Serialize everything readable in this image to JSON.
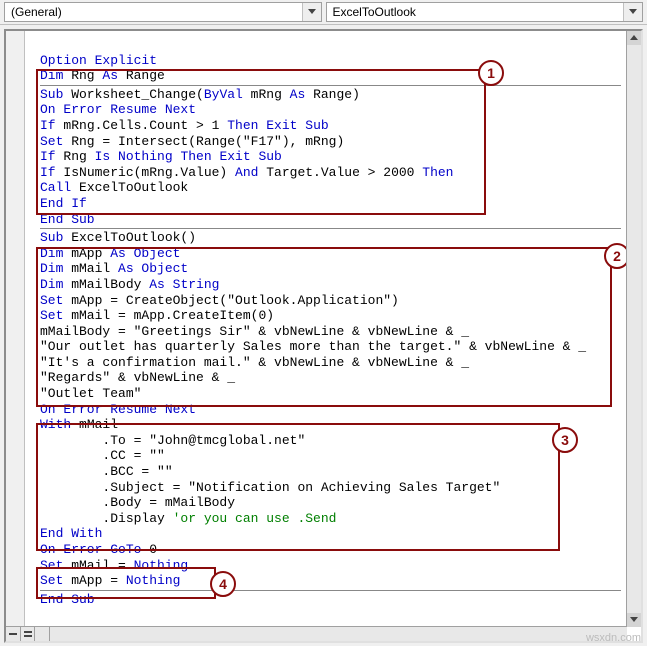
{
  "toolbar": {
    "left_dropdown": "(General)",
    "right_dropdown": "ExcelToOutlook"
  },
  "code": {
    "l01": {
      "a": "Option Explicit"
    },
    "l02": {
      "a": "Dim",
      "b": " Rng ",
      "c": "As",
      "d": " Range"
    },
    "l03": {
      "a": "Sub",
      "b": " Worksheet_Change(",
      "c": "ByVal",
      "d": " mRng ",
      "e": "As",
      "f": " Range)"
    },
    "l04": {
      "a": "On Error Resume Next"
    },
    "l05": {
      "a": "If",
      "b": " mRng.Cells.Count > 1 ",
      "c": "Then Exit Sub"
    },
    "l06": {
      "a": "Set",
      "b": " Rng = Intersect(Range(\"F17\"), mRng)"
    },
    "l07": {
      "a": "If",
      "b": " Rng ",
      "c": "Is Nothing Then Exit Sub"
    },
    "l08": {
      "a": "If",
      "b": " IsNumeric(mRng.Value) ",
      "c": "And",
      "d": " Target.Value > 2000 ",
      "e": "Then"
    },
    "l09": {
      "a": "Call",
      "b": " ExcelToOutlook"
    },
    "l10": {
      "a": "End If"
    },
    "l11": {
      "a": "End Sub"
    },
    "l12": {
      "a": "Sub",
      "b": " ExcelToOutlook()"
    },
    "l13": {
      "a": "Dim",
      "b": " mApp ",
      "c": "As Object"
    },
    "l14": {
      "a": "Dim",
      "b": " mMail ",
      "c": "As Object"
    },
    "l15": {
      "a": "Dim",
      "b": " mMailBody ",
      "c": "As String"
    },
    "l16": {
      "a": "Set",
      "b": " mApp = CreateObject(\"Outlook.Application\")"
    },
    "l17": {
      "a": "Set",
      "b": " mMail = mApp.CreateItem(0)"
    },
    "l18": {
      "a": "mMailBody = \"Greetings Sir\" & vbNewLine & vbNewLine & _"
    },
    "l19": {
      "a": "\"Our outlet has quarterly Sales more than the target.\" & vbNewLine & _"
    },
    "l20": {
      "a": "\"It's a confirmation mail.\" & vbNewLine & vbNewLine & _"
    },
    "l21": {
      "a": "\"Regards\" & vbNewLine & _"
    },
    "l22": {
      "a": "\"Outlet Team\""
    },
    "l23": {
      "a": "On Error Resume Next"
    },
    "l24": {
      "a": "With",
      "b": " mMail"
    },
    "l25": {
      "a": "        .To = \"John@tmcglobal.net\""
    },
    "l26": {
      "a": "        .CC = \"\""
    },
    "l27": {
      "a": "        .BCC = \"\""
    },
    "l28": {
      "a": "        .Subject = \"Notification on Achieving Sales Target\""
    },
    "l29": {
      "a": "        .Body = mMailBody"
    },
    "l30": {
      "a": "        .Display ",
      "b": "'or you can use .Send"
    },
    "l31": {
      "a": "End With"
    },
    "l32": {
      "a": "On Error GoTo",
      "b": " 0"
    },
    "l33": {
      "a": "Set",
      "b": " mMail = ",
      "c": "Nothing"
    },
    "l34": {
      "a": "Set",
      "b": " mApp = ",
      "c": "Nothing"
    },
    "l35": {
      "a": "End Sub"
    }
  },
  "annotations": {
    "b1": "1",
    "b2": "2",
    "b3": "3",
    "b4": "4"
  },
  "watermark": "wsxdn.com"
}
